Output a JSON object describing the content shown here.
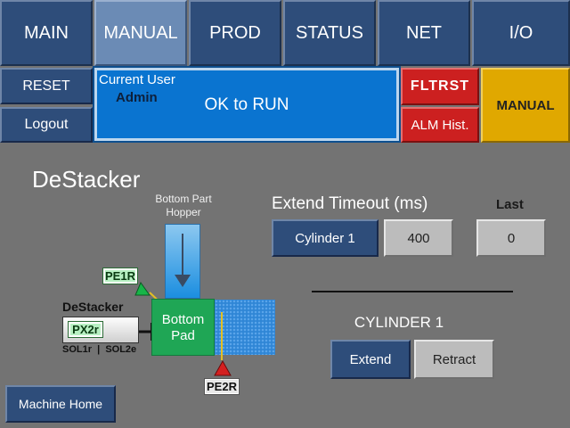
{
  "tabs": [
    {
      "label": "MAIN"
    },
    {
      "label": "MANUAL"
    },
    {
      "label": "PROD"
    },
    {
      "label": "STATUS"
    },
    {
      "label": "NET"
    },
    {
      "label": "I/O"
    }
  ],
  "sidebar": {
    "reset": "RESET",
    "logout": "Logout"
  },
  "status": {
    "current_user_label": "Current User",
    "user": "Admin",
    "message": "OK to RUN"
  },
  "faults": {
    "flt_rst": "FLTRST",
    "alm_hist": "ALM Hist."
  },
  "mode_badge": "MANUAL",
  "page_title": "DeStacker",
  "hopper_label": "Bottom Part\nHopper",
  "diagram": {
    "pe1r": "PE1R",
    "pe2r": "PE2R",
    "destacker_label": "DeStacker",
    "px2r": "PX2r",
    "sol_label": "SOL1r  |  SOL2e",
    "pad_label": "Bottom\nPad"
  },
  "timeout": {
    "title": "Extend Timeout (ms)",
    "last_label": "Last",
    "cylinder_button": "Cylinder 1",
    "value": "400",
    "last_value": "0"
  },
  "cylinder": {
    "title": "CYLINDER 1",
    "extend": "Extend",
    "retract": "Retract"
  },
  "machine_home": "Machine Home",
  "colors": {
    "accent": "#0a74d0",
    "fault": "#cc2020",
    "mode": "#e0a800",
    "pad": "#1fa655"
  }
}
